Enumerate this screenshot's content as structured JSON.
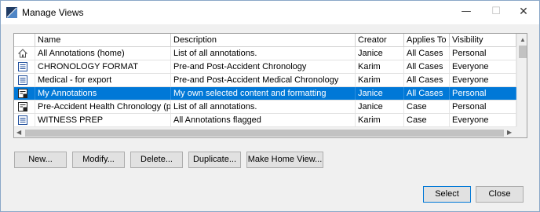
{
  "window": {
    "title": "Manage Views"
  },
  "table": {
    "headers": {
      "name": "Name",
      "description": "Description",
      "creator": "Creator",
      "applies_to": "Applies To",
      "visibility": "Visibility"
    },
    "rows": [
      {
        "icon": "home-icon",
        "name": "All Annotations (home)",
        "description": "List of all annotations.",
        "creator": "Janice",
        "applies_to": "All Cases",
        "visibility": "Personal"
      },
      {
        "icon": "document-icon",
        "name": "CHRONOLOGY FORMAT",
        "description": "Pre-and Post-Accident Chronology",
        "creator": "Karim",
        "applies_to": "All Cases",
        "visibility": "Everyone"
      },
      {
        "icon": "document-icon",
        "name": "Medical - for export",
        "description": "Pre-and Post-Accident Medical Chronology",
        "creator": "Karim",
        "applies_to": "All Cases",
        "visibility": "Everyone"
      },
      {
        "icon": "personal-document-icon",
        "name": "My Annotations",
        "description": "My own selected content and formatting",
        "creator": "Janice",
        "applies_to": "All Cases",
        "visibility": "Personal",
        "selected": true
      },
      {
        "icon": "personal-document-icon",
        "name": "Pre-Accident Health Chronology (p)",
        "description": "List of all annotations.",
        "creator": "Janice",
        "applies_to": "Case",
        "visibility": "Personal"
      },
      {
        "icon": "document-icon",
        "name": "WITNESS PREP",
        "description": "All Annotations flagged",
        "creator": "Karim",
        "applies_to": "Case",
        "visibility": "Everyone"
      }
    ]
  },
  "buttons": {
    "new": "New...",
    "modify": "Modify...",
    "delete": "Delete...",
    "duplicate": "Duplicate...",
    "make_home_view": "Make Home View...",
    "select": "Select",
    "close": "Close"
  },
  "colors": {
    "selection": "#0078d7",
    "default_button_border": "#0078d7"
  }
}
